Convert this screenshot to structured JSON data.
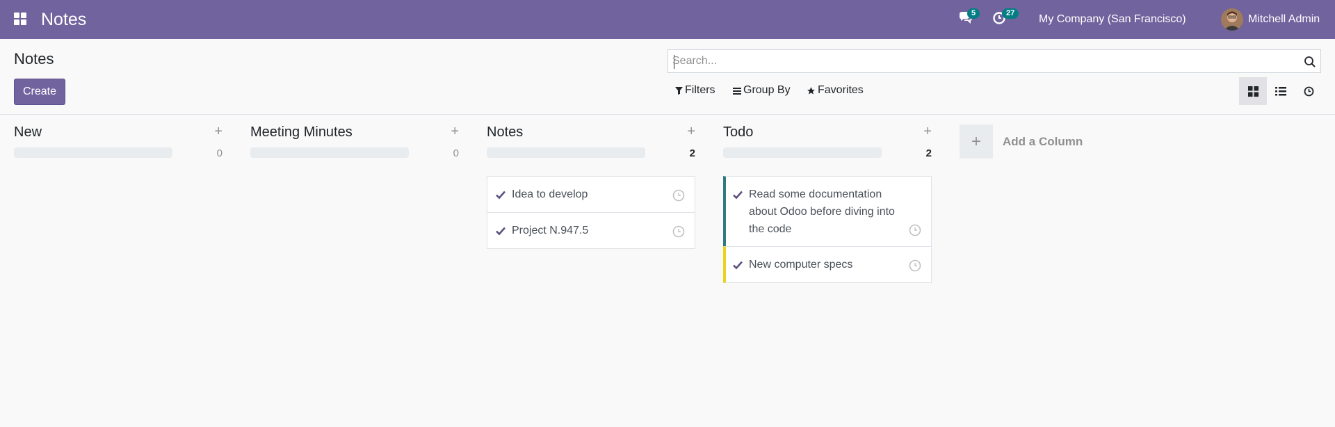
{
  "navbar": {
    "app_title": "Notes",
    "messages_count": "5",
    "activities_count": "27",
    "company": "My Company (San Francisco)",
    "user_name": "Mitchell Admin",
    "accent_color": "#71639e"
  },
  "control_panel": {
    "title": "Notes",
    "create_label": "Create",
    "search_placeholder": "Search...",
    "filters_label": "Filters",
    "groupby_label": "Group By",
    "favorites_label": "Favorites",
    "views": [
      "kanban",
      "list",
      "activity"
    ],
    "active_view": "kanban"
  },
  "kanban": {
    "columns": [
      {
        "title": "New",
        "count": "0",
        "cards": []
      },
      {
        "title": "Meeting Minutes",
        "count": "0",
        "cards": []
      },
      {
        "title": "Notes",
        "count": "2",
        "cards": [
          {
            "text": "Idea to develop"
          },
          {
            "text": "Project N.947.5"
          }
        ]
      },
      {
        "title": "Todo",
        "count": "2",
        "cards": [
          {
            "text": "Read some documentation about Odoo before diving into the code",
            "color": "#30797f"
          },
          {
            "text": "New computer specs",
            "color": "#ead21e"
          }
        ]
      }
    ],
    "add_column_label": "Add a Column"
  }
}
